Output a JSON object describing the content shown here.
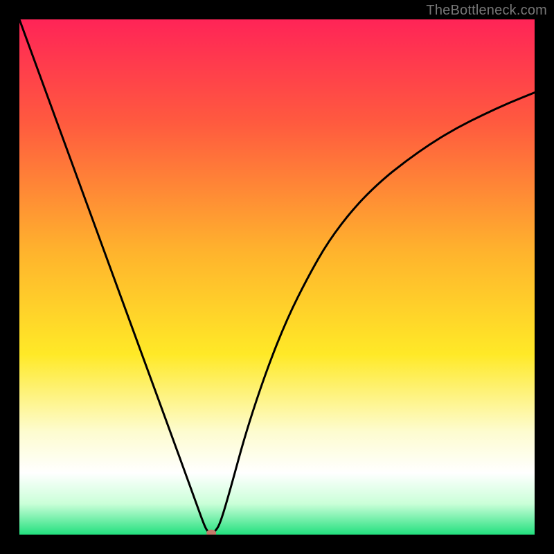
{
  "watermark": "TheBottleneck.com",
  "chart_data": {
    "type": "line",
    "title": "",
    "xlabel": "",
    "ylabel": "",
    "xlim": [
      0,
      100
    ],
    "ylim": [
      0,
      100
    ],
    "grid": false,
    "series": [
      {
        "name": "curve",
        "x": [
          0,
          3,
          6,
          9,
          12,
          15,
          18,
          21,
          24,
          27,
          30,
          32,
          34,
          35.8,
          36.5,
          37.25,
          38,
          39,
          41,
          44,
          48,
          52,
          56,
          60,
          65,
          70,
          75,
          80,
          85,
          90,
          95,
          100
        ],
        "values": [
          100,
          91.8,
          83.6,
          75.4,
          67.2,
          59,
          50.8,
          42.6,
          34.4,
          26.2,
          18,
          12.5,
          7,
          2,
          0.6,
          0.3,
          0.6,
          2.2,
          9,
          20,
          32,
          42,
          50,
          57,
          63.5,
          68.5,
          72.5,
          76,
          79,
          81.5,
          83.8,
          85.8
        ]
      }
    ],
    "marker": {
      "x": 37.25,
      "y": 0.3,
      "color": "#c47a6a"
    },
    "background_gradient": {
      "stops": [
        {
          "pct": 0,
          "color": "#ff2457"
        },
        {
          "pct": 20,
          "color": "#ff5a3f"
        },
        {
          "pct": 45,
          "color": "#ffb32d"
        },
        {
          "pct": 65,
          "color": "#ffe927"
        },
        {
          "pct": 80,
          "color": "#fdfccf"
        },
        {
          "pct": 88,
          "color": "#ffffff"
        },
        {
          "pct": 94,
          "color": "#caffd8"
        },
        {
          "pct": 100,
          "color": "#22e07e"
        }
      ]
    }
  }
}
